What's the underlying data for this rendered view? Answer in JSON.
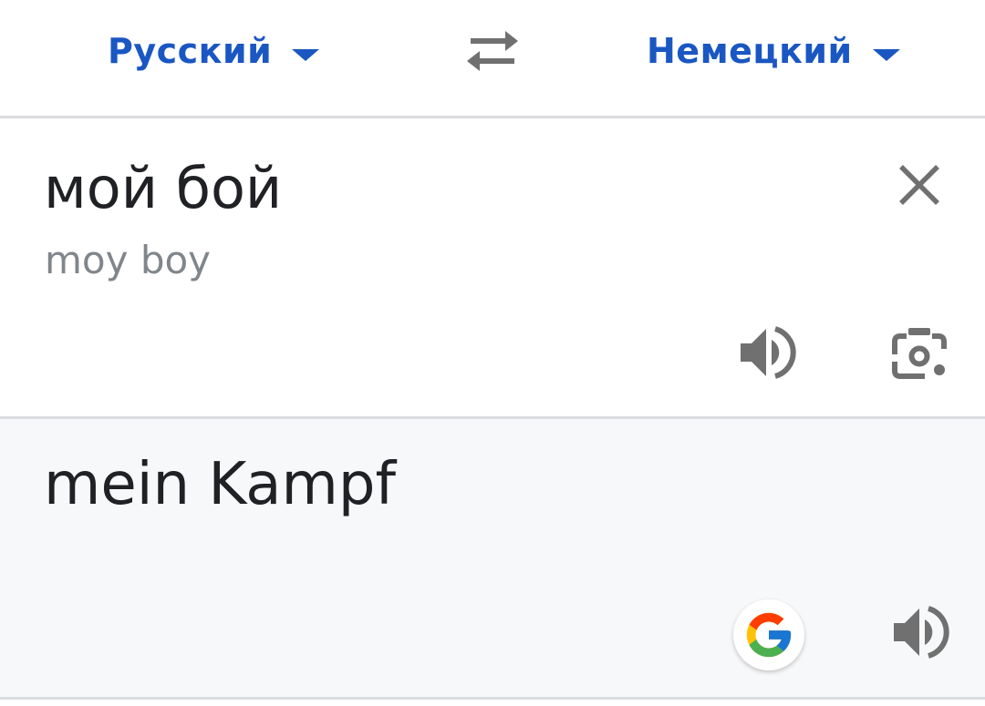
{
  "languages": {
    "source": "Русский",
    "target": "Немецкий"
  },
  "icons": {
    "swap": "swap-arrows-icon",
    "close": "close-icon",
    "speaker": "speaker-icon",
    "camera": "camera-lens-icon",
    "google": "google-g-icon",
    "caret": "caret-down-icon"
  },
  "source": {
    "text": "мой бой",
    "transliteration": "moy boy"
  },
  "result": {
    "text": "mein Kampf"
  },
  "colors": {
    "accent": "#1a57c2",
    "text": "#202124",
    "secondary_text": "#80868b",
    "icon": "#707070",
    "result_background": "#f7f8fa",
    "divider": "#dadce0"
  }
}
